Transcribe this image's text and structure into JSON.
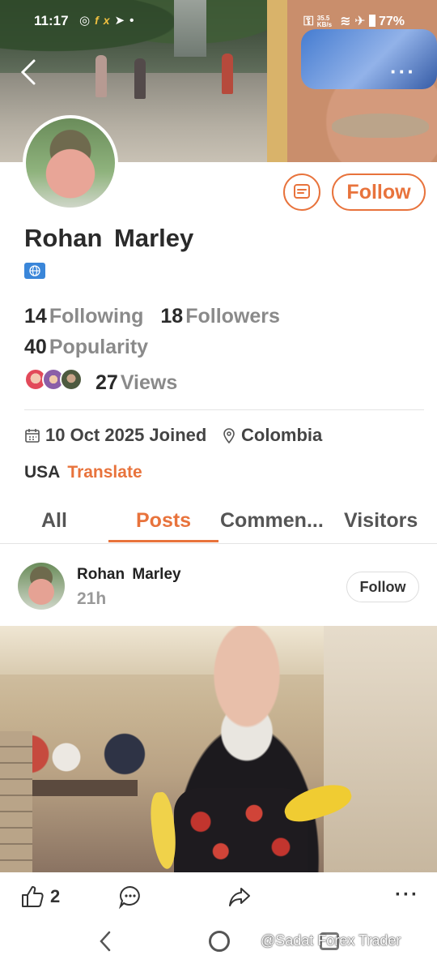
{
  "status_bar": {
    "time": "11:17",
    "left_icons": [
      "data-saver-icon",
      "fx-icon",
      "telegram-icon",
      "dot-icon"
    ],
    "net_speed": "35.5 KB/s",
    "battery": "77%"
  },
  "profile": {
    "name": "Rohan  Marley",
    "follow_label": "Follow",
    "following_count": "14",
    "following_label": "Following",
    "followers_count": "18",
    "followers_label": "Followers",
    "popularity_count": "40",
    "popularity_label": "Popularity",
    "views_count": "27",
    "views_label": "Views",
    "joined_text": "10 Oct 2025 Joined",
    "location": "Colombia",
    "country_text": "USA",
    "translate_label": "Translate"
  },
  "tabs": [
    {
      "label": "All"
    },
    {
      "label": "Posts"
    },
    {
      "label": "Commen..."
    },
    {
      "label": "Visitors"
    }
  ],
  "active_tab": "Posts",
  "post": {
    "author": "Rohan  Marley",
    "time": "21h",
    "follow_label": "Follow",
    "like_count": "2"
  },
  "watermark": "@Sadat Forex Trader",
  "colors": {
    "accent": "#e8733c",
    "globe_badge": "#3a86d9",
    "muted_text": "#8a8a8a"
  }
}
